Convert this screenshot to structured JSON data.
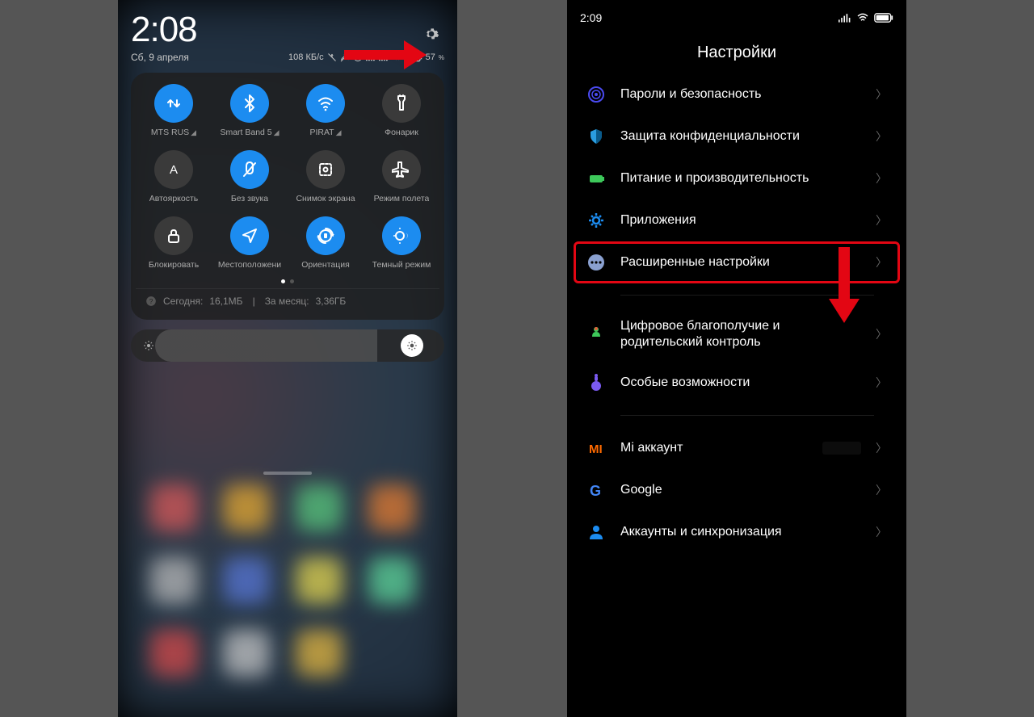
{
  "left": {
    "time": "2:08",
    "date": "Сб, 9 апреля",
    "speed": "108 КБ/с",
    "battery_pct": "57",
    "battery_unit": "%",
    "qs": [
      {
        "label": "MTS RUS",
        "on": true,
        "icon": "data"
      },
      {
        "label": "Smart Band 5",
        "on": true,
        "icon": "bluetooth"
      },
      {
        "label": "PIRAT",
        "on": true,
        "icon": "wifi"
      },
      {
        "label": "Фонарик",
        "on": false,
        "icon": "flashlight"
      },
      {
        "label": "Автояркость",
        "on": false,
        "icon": "brightness-a"
      },
      {
        "label": "Без звука",
        "on": true,
        "icon": "mute"
      },
      {
        "label": "Снимок экрана",
        "on": false,
        "icon": "screenshot"
      },
      {
        "label": "Режим полета",
        "on": false,
        "icon": "airplane"
      },
      {
        "label": "Блокировать",
        "on": false,
        "icon": "lock"
      },
      {
        "label": "Местоположени",
        "on": true,
        "icon": "location"
      },
      {
        "label": "Ориентация",
        "on": true,
        "icon": "orientation"
      },
      {
        "label": "Темный режим",
        "on": true,
        "icon": "dark"
      }
    ],
    "usage_today_label": "Сегодня:",
    "usage_today": "16,1МБ",
    "usage_sep": "|",
    "usage_month_label": "За месяц:",
    "usage_month": "3,36ГБ"
  },
  "right": {
    "time": "2:09",
    "title": "Настройки",
    "items": [
      {
        "label": "Пароли и безопасность",
        "icon": "fingerprint",
        "color": "#4a4af0"
      },
      {
        "label": "Защита конфиденциальности",
        "icon": "privacy",
        "color": "#2a9de0"
      },
      {
        "label": "Питание и производительность",
        "icon": "battery",
        "color": "#3dc85a"
      },
      {
        "label": "Приложения",
        "icon": "apps-gear",
        "color": "#1c8cf0"
      },
      {
        "label": "Расширенные настройки",
        "icon": "dots",
        "color": "#8aa0d0",
        "highlight": true
      },
      {
        "label": "Цифровое благополучие и родительский контроль",
        "icon": "wellbeing",
        "color": "#3dc85a"
      },
      {
        "label": "Особые возможности",
        "icon": "accessibility",
        "color": "#7a5af0"
      },
      {
        "label": "Mi аккаунт",
        "icon": "mi",
        "color": "#ff6a00",
        "badge": true
      },
      {
        "label": "Google",
        "icon": "google",
        "color": ""
      },
      {
        "label": "Аккаунты и синхронизация",
        "icon": "account",
        "color": "#1c8cf0"
      }
    ]
  }
}
